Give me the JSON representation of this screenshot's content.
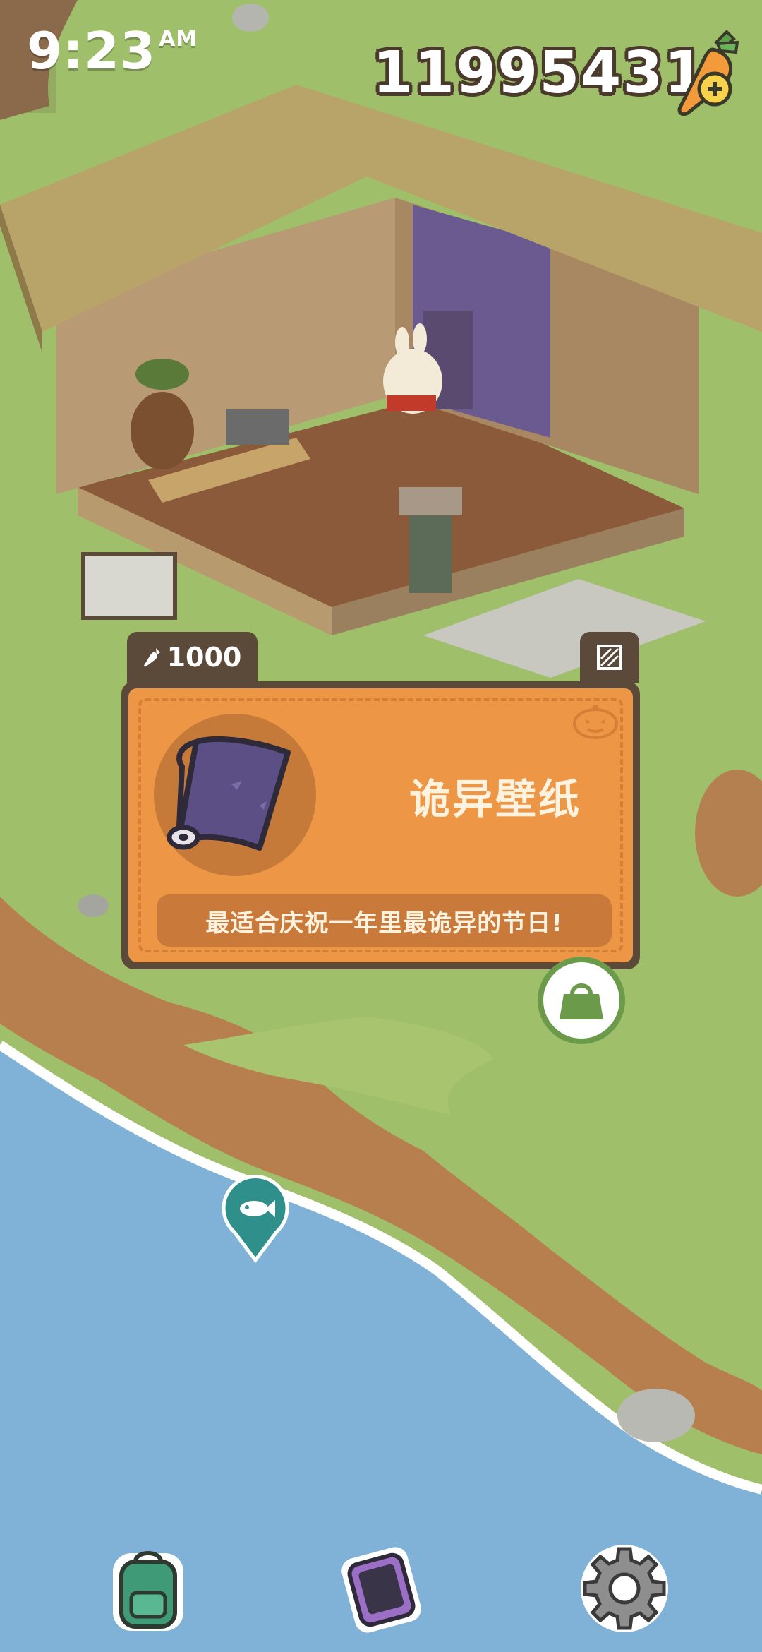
{
  "status_bar": {
    "time": "9:23",
    "ampm": "AM"
  },
  "currency": {
    "carrots": "11995431"
  },
  "item_popup": {
    "price": "1000",
    "name": "诡异壁纸",
    "description": "最适合庆祝一年里最诡异的节日!"
  },
  "icons": {
    "carrot_add": "carrot-plus-icon",
    "shop_bag": "shopping-bag-icon",
    "fish_marker": "fish-icon",
    "backpack": "backpack-icon",
    "phone": "phone-icon",
    "settings": "gear-icon",
    "category": "wallpaper-category-icon"
  },
  "colors": {
    "grass": "#9fbf6a",
    "water": "#7fb2d6",
    "card_orange": "#ec9646",
    "card_border": "#5b4a3a"
  }
}
